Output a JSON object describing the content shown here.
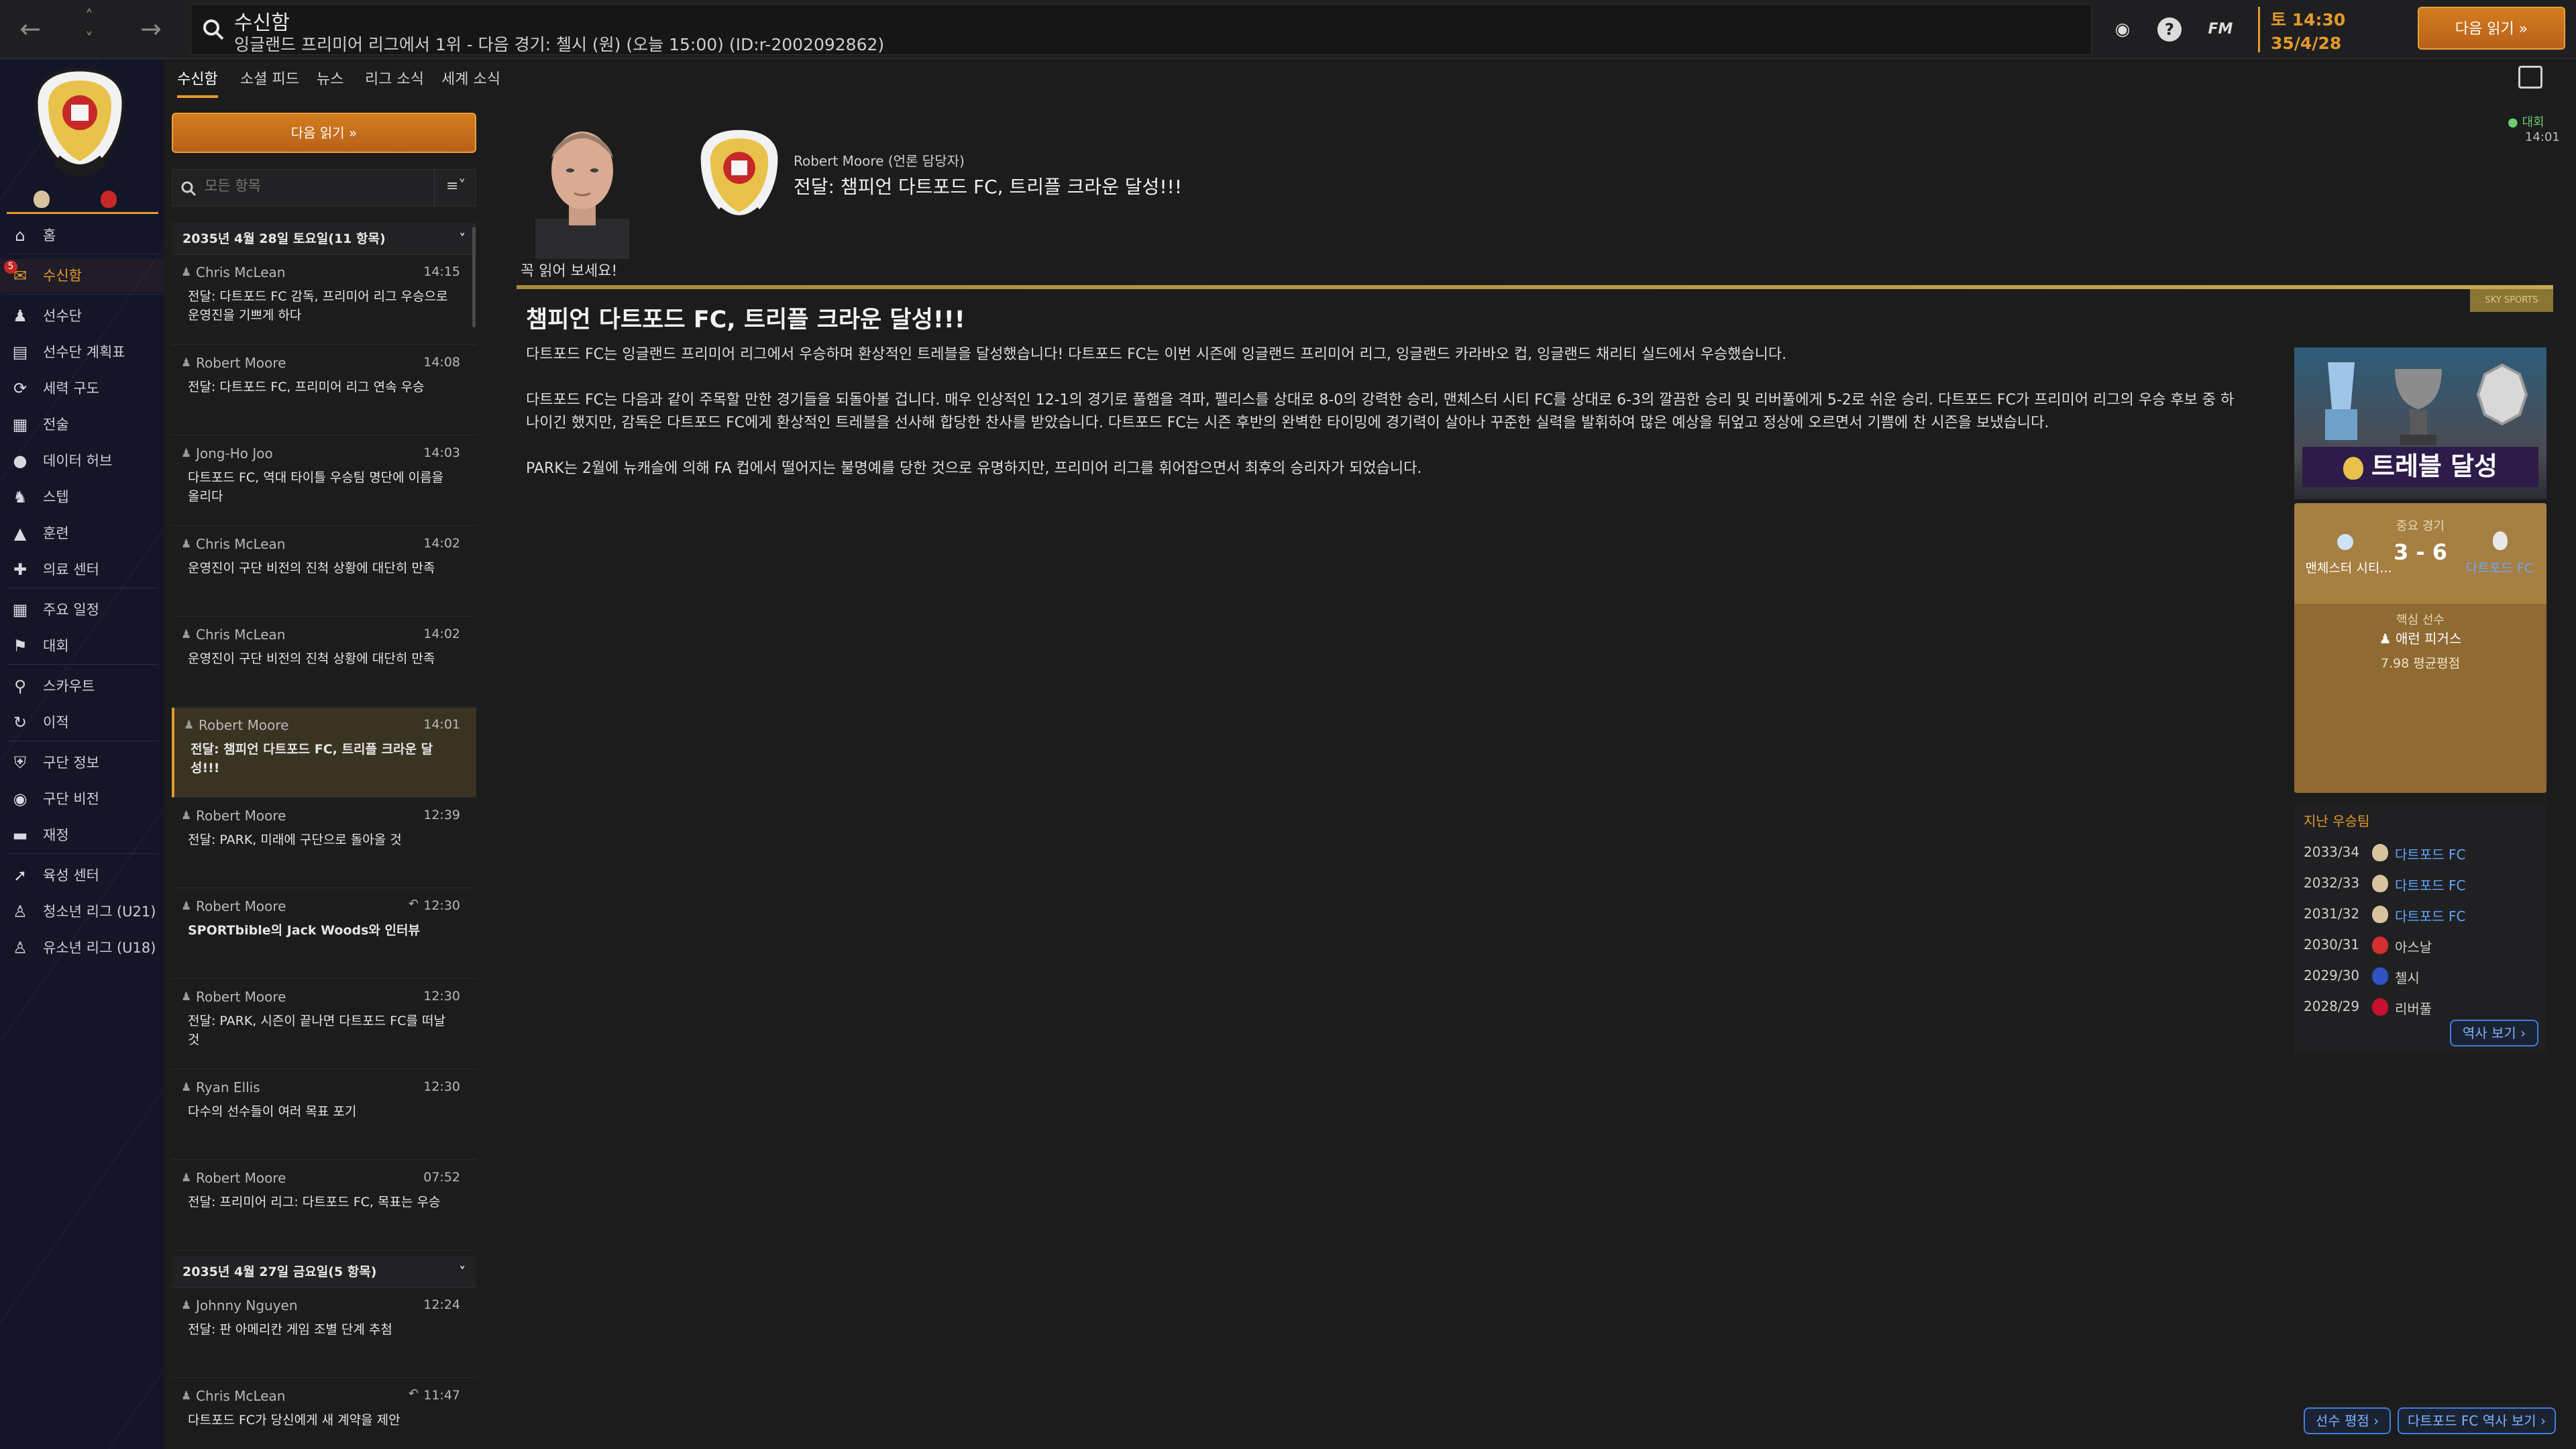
{
  "topbar": {
    "title": "수신함",
    "subtitle": "잉글랜드 프리미어 리그에서 1위 - 다음 경기: 첼시 (원) (오늘 15:00) (ID:r-2002092862)",
    "time": "토 14:30",
    "date": "35/4/28",
    "continue_label": "다음 읽기",
    "fm_label": "FM",
    "help_label": "?"
  },
  "sidebar": {
    "badge_count": "5",
    "items": [
      {
        "label": "홈",
        "icon": "home-icon"
      },
      {
        "label": "수신함",
        "icon": "inbox-icon"
      },
      {
        "label": "선수단",
        "icon": "squad-icon"
      },
      {
        "label": "선수단 계획표",
        "icon": "squad-planner-icon"
      },
      {
        "label": "세력 구도",
        "icon": "dynamics-icon"
      },
      {
        "label": "전술",
        "icon": "tactics-icon"
      },
      {
        "label": "데이터 허브",
        "icon": "data-hub-icon"
      },
      {
        "label": "스텝",
        "icon": "staff-icon"
      },
      {
        "label": "훈련",
        "icon": "training-icon"
      },
      {
        "label": "의료 센터",
        "icon": "medical-icon"
      },
      {
        "label": "주요 일정",
        "icon": "calendar-icon"
      },
      {
        "label": "대회",
        "icon": "trophy-icon"
      },
      {
        "label": "스카우트",
        "icon": "scouting-icon"
      },
      {
        "label": "이적",
        "icon": "transfers-icon"
      },
      {
        "label": "구단 정보",
        "icon": "club-info-icon"
      },
      {
        "label": "구단 비전",
        "icon": "club-vision-icon"
      },
      {
        "label": "재정",
        "icon": "finances-icon"
      },
      {
        "label": "육성 센터",
        "icon": "development-icon"
      },
      {
        "label": "청소년 리그 (U21)",
        "icon": "u21-icon"
      },
      {
        "label": "유소년 리그 (U18)",
        "icon": "u18-icon"
      }
    ]
  },
  "subtabs": [
    "수신함",
    "소셜 피드",
    "뉴스",
    "리그 소식",
    "세계 소식"
  ],
  "msglist": {
    "continue_label": "다음 읽기",
    "search_placeholder": "모든 항목",
    "groups": [
      {
        "date": "2035년 4월 28일 토요일(11 항목)"
      },
      {
        "date": "2035년 4월 27일 금요일(5 항목)"
      }
    ],
    "messages": [
      {
        "sender": "Chris McLean",
        "time": "14:15",
        "subject": "전달: 다트포드 FC 감독, 프리미어 리그 우승으로 운영진을 기쁘게 하다"
      },
      {
        "sender": "Robert Moore",
        "time": "14:08",
        "subject": "전달: 다트포드 FC, 프리미어 리그 연속 우승"
      },
      {
        "sender": "Jong-Ho Joo",
        "time": "14:03",
        "subject": "다트포드 FC, 역대 타이틀 우승팀 명단에 이름을 올리다"
      },
      {
        "sender": "Chris McLean",
        "time": "14:02",
        "subject": "운영진이 구단 비전의 진척 상황에 대단히 만족"
      },
      {
        "sender": "Chris McLean",
        "time": "14:02",
        "subject": "운영진이 구단 비전의 진척 상황에 대단히 만족"
      },
      {
        "sender": "Robert Moore",
        "time": "14:01",
        "subject": "전달: 챔피언 다트포드 FC, 트리플 크라운 달성!!!"
      },
      {
        "sender": "Robert Moore",
        "time": "12:39",
        "subject": "전달: PARK, 미래에 구단으로 돌아올 것"
      },
      {
        "sender": "Robert Moore",
        "time": "12:30",
        "subject": "SPORTbible의 Jack Woods와 인터뷰"
      },
      {
        "sender": "Robert Moore",
        "time": "12:30",
        "subject": "전달: PARK, 시즌이 끝나면 다트포드 FC를 떠날 것"
      },
      {
        "sender": "Ryan Ellis",
        "time": "12:30",
        "subject": "다수의 선수들이 여러 목표 포기"
      },
      {
        "sender": "Robert Moore",
        "time": "07:52",
        "subject": "전달: 프리미어 리그: 다트포드 FC, 목표는 우승"
      },
      {
        "sender": "Johnny Nguyen",
        "time": "12:24",
        "subject": "전달: 판 아메리칸 게임 조별 단계 추첨"
      },
      {
        "sender": "Chris McLean",
        "time": "11:47",
        "subject": "다트포드 FC가 당신에게 새 계약을 제안"
      }
    ]
  },
  "mail": {
    "from": "Robert Moore (언론 담당자)",
    "title": "전달: 챔피언 다트포드 FC, 트리플 크라운 달성!!!",
    "tag_label": "대회",
    "tag_time": "14:01",
    "must_read": "꼭 읽어 보세요!",
    "source": "SKY SPORTS",
    "article_title": "챔피언 다트포드 FC, 트리플 크라운 달성!!!",
    "para1": "다트포드 FC는 잉글랜드 프리미어 리그에서 우승하며 환상적인 트레블을 달성했습니다! 다트포드 FC는 이번 시즌에 잉글랜드 프리미어 리그, 잉글랜드 카라바오 컵, 잉글랜드 채리티 실드에서 우승했습니다.",
    "para2": "다트포드 FC는 다음과 같이 주목할 만한 경기들을 되돌아볼 겁니다. 매우 인상적인 12-1의 경기로 풀햄을 격파, 펠리스를 상대로 8-0의 강력한 승리, 맨체스터 시티 FC를 상대로 6-3의 깔끔한 승리 및 리버풀에게 5-2로 쉬운 승리. 다트포드 FC가 프리미어 리그의 우승 후보 중 하나이긴 했지만, 감독은 다트포드 FC에게 환상적인 트레블을 선사해 합당한 찬사를 받았습니다. 다트포드 FC는 시즌 후반의 완벽한 타이밍에 경기력이 살아나 꾸준한 실력을 발휘하여 많은 예상을 뒤엎고 정상에 오르면서 기쁨에 찬 시즌을 보냈습니다.",
    "para3": "PARK는 2월에 뉴캐슬에 의해 FA 컵에서 떨어지는 불명예를 당한 것으로 유명하지만, 프리미어 리그를 휘어잡으면서 최후의 승리자가 되었습니다."
  },
  "sidecards": {
    "treble_label": "트레블 달성",
    "key_match_label": "중요 경기",
    "home_team": "맨체스터 시티...",
    "score": "3 - 6",
    "away_team": "다트포드 FC",
    "key_player_label": "핵심 선수",
    "key_player": "애런 피거스",
    "key_player_rating": "7.98 평균평점",
    "honours_label": "지난 우승팀",
    "honours": [
      {
        "season": "2033/34",
        "club": "다트포드 FC",
        "color": "#d8c2a0",
        "blue": true
      },
      {
        "season": "2032/33",
        "club": "다트포드 FC",
        "color": "#d8c2a0",
        "blue": true
      },
      {
        "season": "2031/32",
        "club": "다트포드 FC",
        "color": "#d8c2a0",
        "blue": true
      },
      {
        "season": "2030/31",
        "club": "아스날",
        "color": "#d32f2f",
        "blue": false
      },
      {
        "season": "2029/30",
        "club": "첼시",
        "color": "#2f52c4",
        "blue": false
      },
      {
        "season": "2028/29",
        "club": "리버풀",
        "color": "#c8102e",
        "blue": false
      }
    ],
    "history_button": "역사 보기"
  },
  "footer": {
    "player_ratings_button": "선수 평점",
    "club_history_button": "다트포드 FC 역사 보기"
  },
  "colors": {
    "accent": "#e39a2b",
    "link_blue": "#5ea6ff",
    "panel": "#1c1c1d"
  }
}
